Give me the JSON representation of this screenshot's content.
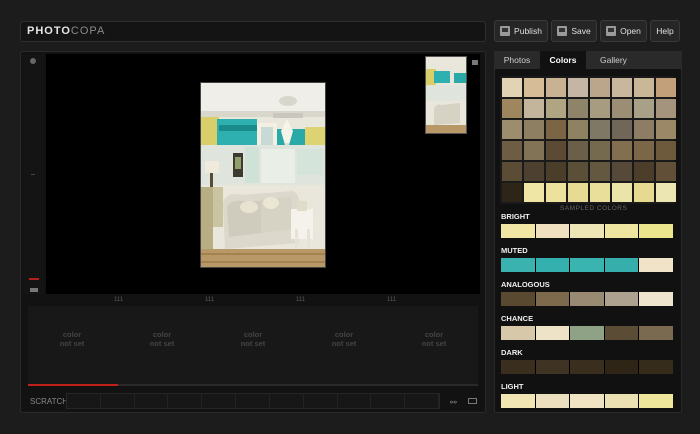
{
  "app": {
    "logo_primary": "PHOTO",
    "logo_secondary": "COPA"
  },
  "toolbar": {
    "publish": "Publish",
    "save": "Save",
    "open": "Open",
    "help": "Help"
  },
  "ruler_ticks": [
    "111",
    "111",
    "111",
    "111"
  ],
  "slots": [
    {
      "line1": "color",
      "line2": "not set"
    },
    {
      "line1": "color",
      "line2": "not set"
    },
    {
      "line1": "color",
      "line2": "not set"
    },
    {
      "line1": "color",
      "line2": "not set"
    },
    {
      "line1": "color",
      "line2": "not set"
    }
  ],
  "progress": 0.2,
  "scratch": {
    "label": "SCRATCH"
  },
  "tabs": [
    {
      "label": "Photos",
      "active": false
    },
    {
      "label": "Colors",
      "active": true
    },
    {
      "label": "Gallery",
      "active": false
    }
  ],
  "sampled_label": "SAMPLED COLORS",
  "sampled_grid": [
    [
      "#e2d3b4",
      "#d6bd98",
      "#c9b294",
      "#c5b5a5",
      "#bca68b",
      "#c8b79d",
      "#c9b897",
      "#c1a07a"
    ],
    [
      "#9e865f",
      "#c2b59b",
      "#b0a582",
      "#8e8469",
      "#a79c80",
      "#9b8e75",
      "#a9a088",
      "#a4947d"
    ],
    [
      "#9c8d6e",
      "#8e7e62",
      "#7c6544",
      "#8f8262",
      "#7f7865",
      "#706758",
      "#8d7d64",
      "#9a8866"
    ],
    [
      "#6e5c45",
      "#827357",
      "#5b4b34",
      "#6c5f4a",
      "#75694e",
      "#826f50",
      "#7b6648",
      "#6d5a3d"
    ],
    [
      "#5a4c35",
      "#4e4030",
      "#4a3e2b",
      "#5c4f38",
      "#655840",
      "#56493a",
      "#4c3e2a",
      "#614f37"
    ],
    [
      "#2d2518",
      "#efe6a6",
      "#ece29c",
      "#e7db93",
      "#eadf9a",
      "#ebe4a8",
      "#e6da90",
      "#ece6b2"
    ]
  ],
  "palettes": [
    {
      "label": "BRIGHT",
      "colors": [
        "#f1e6a3",
        "#efe0c0",
        "#eee5b6",
        "#eee6a0",
        "#ebe58e"
      ]
    },
    {
      "label": "MUTED",
      "colors": [
        "#3ab3b0",
        "#34b0ae",
        "#39b4b1",
        "#36aeab",
        "#f0e3c8"
      ]
    },
    {
      "label": "ANALOGOUS",
      "colors": [
        "#5a4931",
        "#7d6a4d",
        "#988a73",
        "#ada18f",
        "#eee3cc"
      ]
    },
    {
      "label": "CHANCE",
      "colors": [
        "#d6c8a8",
        "#eee3c6",
        "#8fa286",
        "#5b4c36",
        "#7a6a50"
      ]
    },
    {
      "label": "DARK",
      "colors": [
        "#3a2f1f",
        "#3f3424",
        "#3a2e1e",
        "#2f2517",
        "#362c1c"
      ]
    },
    {
      "label": "LIGHT",
      "colors": [
        "#f1e6b3",
        "#ecdfbf",
        "#efe3c4",
        "#eae0b2",
        "#eee69a"
      ]
    }
  ]
}
